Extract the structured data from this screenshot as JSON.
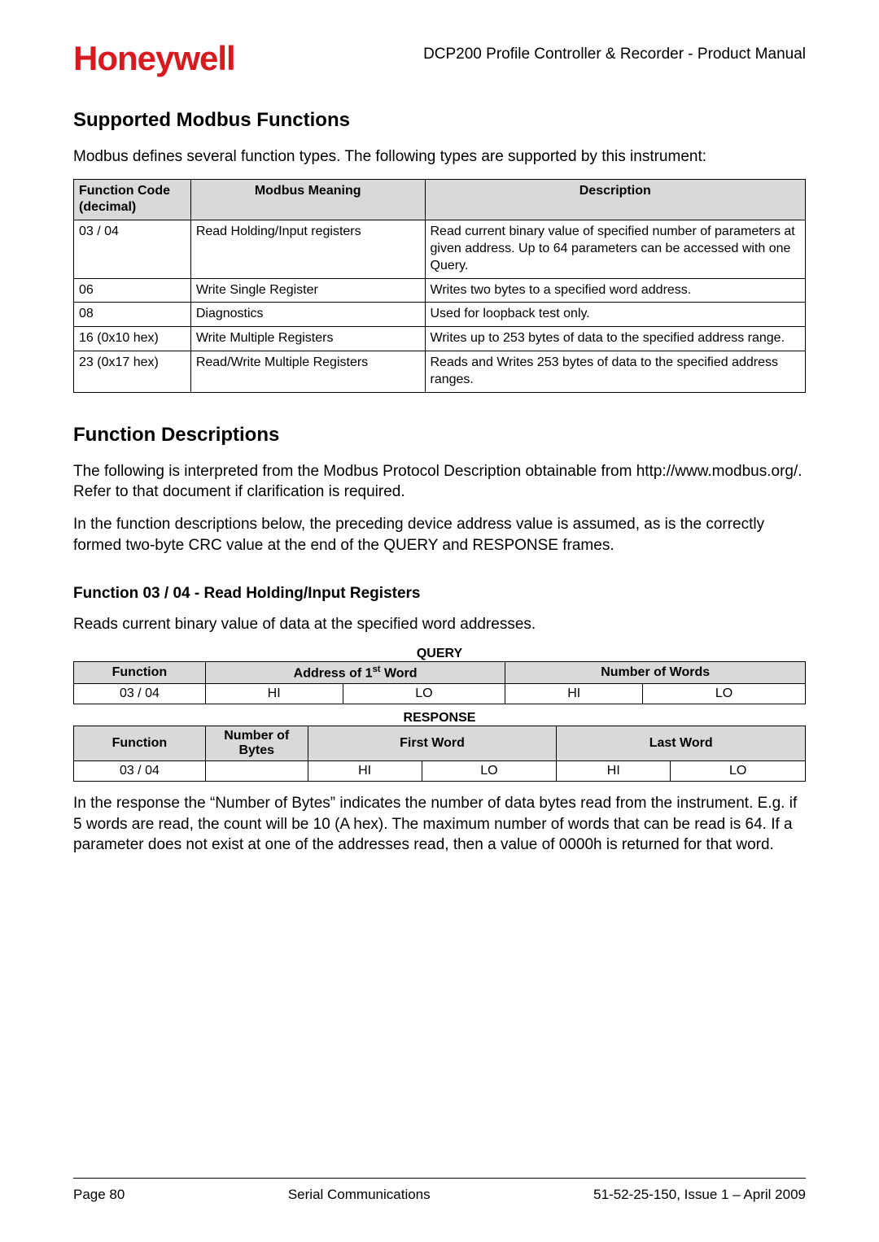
{
  "header": {
    "logo": "Honeywell",
    "doc_title": "DCP200 Profile Controller & Recorder - Product Manual"
  },
  "section1": {
    "title": "Supported Modbus Functions",
    "intro": "Modbus defines several function types. The following types are supported by this instrument:",
    "table": {
      "headers": {
        "code": "Function Code (decimal)",
        "meaning": "Modbus Meaning",
        "desc": "Description"
      },
      "rows": [
        {
          "code": "03 / 04",
          "meaning": "Read Holding/Input registers",
          "desc": "Read current binary value of specified number of parameters at given address. Up to 64 parameters can be accessed with one Query."
        },
        {
          "code": "06",
          "meaning": "Write Single Register",
          "desc": "Writes two bytes to a specified word address."
        },
        {
          "code": "08",
          "meaning": "Diagnostics",
          "desc": "Used for loopback test only."
        },
        {
          "code": "16 (0x10 hex)",
          "meaning": "Write Multiple Registers",
          "desc": "Writes up to 253 bytes of data to the specified address range."
        },
        {
          "code": "23 (0x17 hex)",
          "meaning": "Read/Write Multiple Registers",
          "desc": "Reads and Writes 253 bytes of data to the specified address ranges."
        }
      ]
    }
  },
  "section2": {
    "title": "Function Descriptions",
    "para1": "The following is interpreted from the Modbus Protocol Description obtainable from http://www.modbus.org/. Refer to that document if clarification is required.",
    "para2": "In the function descriptions below, the preceding device address value is assumed, as is the correctly formed two-byte CRC value at the end of the QUERY and RESPONSE frames."
  },
  "section3": {
    "title": "Function 03 / 04 - Read Holding/Input Registers",
    "intro": "Reads current binary value of data at the specified word addresses.",
    "query": {
      "label": "QUERY",
      "headers": {
        "func": "Function",
        "addr_pre": "Address of 1",
        "addr_sup": "st",
        "addr_post": " Word",
        "num": "Number of Words"
      },
      "row": {
        "func": "03 / 04",
        "addr_hi": "HI",
        "addr_lo": "LO",
        "num_hi": "HI",
        "num_lo": "LO"
      }
    },
    "response": {
      "label": "RESPONSE",
      "headers": {
        "func": "Function",
        "nbytes": "Number of Bytes",
        "first": "First Word",
        "last": "Last Word"
      },
      "row": {
        "func": "03 / 04",
        "nbytes": "",
        "first_hi": "HI",
        "first_lo": "LO",
        "last_hi": "HI",
        "last_lo": "LO"
      }
    },
    "outro": "In the response the “Number of Bytes” indicates the number of data bytes read from the instrument. E.g. if 5 words are read, the count will be 10 (A hex). The maximum number of words that can be read is 64. If a parameter does not exist at one of the addresses read, then a value of 0000h is returned for that word."
  },
  "footer": {
    "left": "Page 80",
    "center": "Serial Communications",
    "right": "51-52-25-150, Issue 1 – April 2009"
  }
}
